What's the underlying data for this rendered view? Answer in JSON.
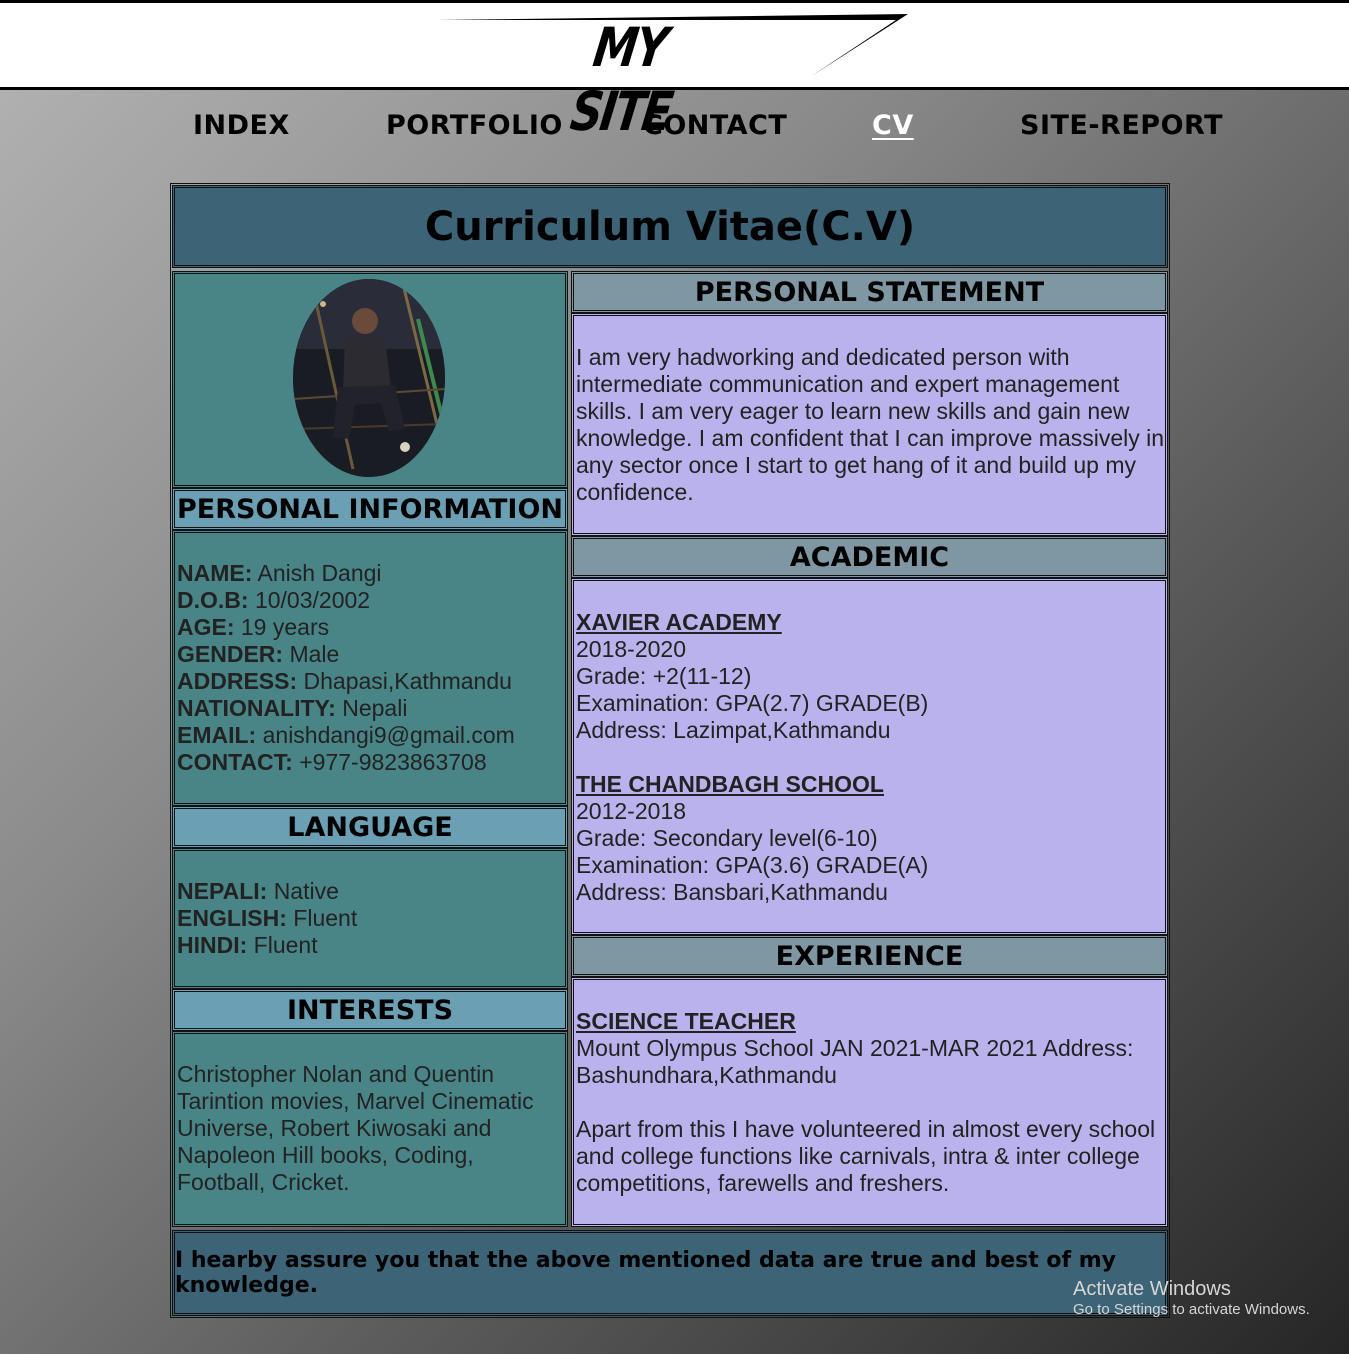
{
  "site": {
    "logo_text": "MY SITE"
  },
  "nav": {
    "items": [
      {
        "label": "INDEX"
      },
      {
        "label": "PORTFOLIO"
      },
      {
        "label": "CONTACT"
      },
      {
        "label": "CV"
      },
      {
        "label": "SITE-REPORT"
      }
    ],
    "active": "CV"
  },
  "cv": {
    "title": "Curriculum Vitae(C.V)",
    "personal_information": {
      "heading": "PERSONAL INFORMATION",
      "fields": [
        {
          "label": "NAME:",
          "value": "Anish Dangi"
        },
        {
          "label": "D.O.B:",
          "value": "10/03/2002"
        },
        {
          "label": "AGE:",
          "value": "19 years"
        },
        {
          "label": "GENDER:",
          "value": "Male"
        },
        {
          "label": "ADDRESS:",
          "value": "Dhapasi,Kathmandu"
        },
        {
          "label": "NATIONALITY:",
          "value": "Nepali"
        },
        {
          "label": "EMAIL:",
          "value": "anishdangi9@gmail.com"
        },
        {
          "label": "CONTACT:",
          "value": "+977-9823863708"
        }
      ]
    },
    "language": {
      "heading": "LANGUAGE",
      "items": [
        {
          "label": "NEPALI:",
          "value": "Native"
        },
        {
          "label": "ENGLISH:",
          "value": "Fluent"
        },
        {
          "label": "HINDI:",
          "value": "Fluent"
        }
      ]
    },
    "interests": {
      "heading": "INTERESTS",
      "lines": [
        "Christopher Nolan and Quentin",
        "Tarintion movies, Marvel Cinematic",
        "Universe, Robert Kiwosaki and",
        "Napoleon Hill books, Coding,",
        "Football, Cricket."
      ]
    },
    "personal_statement": {
      "heading": "PERSONAL STATEMENT",
      "lines": [
        "I am very hadworking and dedicated person with",
        "intermediate communication and expert management",
        "skills. I am very eager to learn new skills and gain new",
        "knowledge. I am confident that I can improve massively in",
        "any sector once I start to get hang of it and build up my",
        "confidence."
      ]
    },
    "academic": {
      "heading": "ACADEMIC",
      "schools": [
        {
          "name": "XAVIER ACADEMY",
          "years": "2018-2020",
          "grade": "Grade: +2(11-12)",
          "exam": "Examination: GPA(2.7) GRADE(B)",
          "address": "Address: Lazimpat,Kathmandu"
        },
        {
          "name": "THE CHANDBAGH SCHOOL",
          "years": "2012-2018",
          "grade": "Grade: Secondary level(6-10)",
          "exam": "Examination: GPA(3.6) GRADE(A)",
          "address": "Address: Bansbari,Kathmandu"
        }
      ]
    },
    "experience": {
      "heading": "EXPERIENCE",
      "job_title": "SCIENCE TEACHER",
      "job_lines": [
        "Mount Olympus School JAN 2021-MAR 2021 Address:",
        "Bashundhara,Kathmandu"
      ],
      "extra_lines": [
        "Apart from this I have volunteered in almost every school",
        "and college functions like carnivals, intra & inter college",
        "competitions, farewells and freshers."
      ]
    },
    "declaration": "I hearby assure you that the above mentioned data are true and best of my knowledge."
  },
  "watermark": {
    "line1": "Activate Windows",
    "line2": "Go to Settings to activate Windows."
  },
  "colors": {
    "panel_teal": "#498587",
    "panel_lavender": "#bab2ec",
    "title_bar": "#3c6376",
    "heading_blue": "#6b9fb4",
    "heading_gray": "#7f96a3"
  }
}
